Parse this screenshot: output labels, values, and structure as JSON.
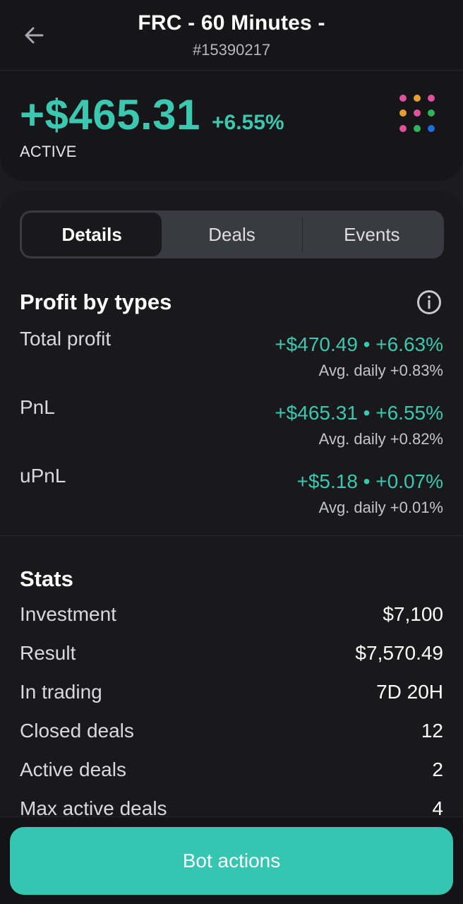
{
  "header": {
    "title": "FRC - 60 Minutes -",
    "subtitle": "#15390217",
    "back_icon": "arrow-left-icon"
  },
  "summary": {
    "amount": "+$465.31",
    "percent": "+6.55%",
    "status": "ACTIVE",
    "grid_icon": "colored-dots-grid-icon",
    "dot_colors": [
      "#e0529c",
      "#e3a02e",
      "#e0529c",
      "#e3a02e",
      "#e0529c",
      "#2fb35b",
      "#e0529c",
      "#2fb35b",
      "#1d6ee0"
    ]
  },
  "tabs": [
    {
      "label": "Details",
      "active": true
    },
    {
      "label": "Deals",
      "active": false
    },
    {
      "label": "Events",
      "active": false
    }
  ],
  "profit": {
    "title": "Profit by types",
    "info_icon": "info-icon",
    "rows": [
      {
        "label": "Total profit",
        "value": "+$470.49 • +6.63%",
        "sub": "Avg. daily +0.83%"
      },
      {
        "label": "PnL",
        "value": "+$465.31 • +6.55%",
        "sub": "Avg. daily +0.82%"
      },
      {
        "label": "uPnL",
        "value": "+$5.18 • +0.07%",
        "sub": "Avg. daily +0.01%"
      }
    ]
  },
  "stats": {
    "title": "Stats",
    "rows": [
      {
        "label": "Investment",
        "value": "$7,100"
      },
      {
        "label": "Result",
        "value": "$7,570.49"
      },
      {
        "label": "In trading",
        "value": "7D 20H"
      },
      {
        "label": "Closed deals",
        "value": "12"
      },
      {
        "label": "Active deals",
        "value": "2"
      },
      {
        "label": "Max active deals",
        "value": "4"
      }
    ]
  },
  "footer": {
    "button_label": "Bot actions"
  },
  "colors": {
    "accent": "#3cc7b0",
    "button": "#35c6b2",
    "background": "#19191b"
  }
}
